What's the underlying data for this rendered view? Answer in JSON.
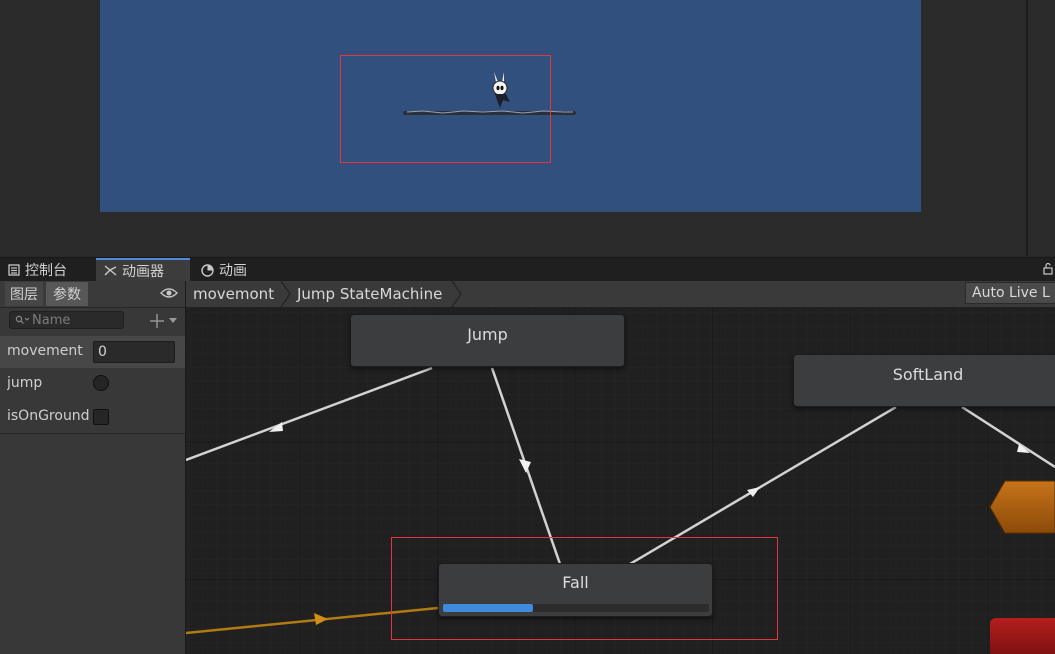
{
  "tabs": [
    {
      "label": "控制台",
      "icon": "console-icon",
      "active": false
    },
    {
      "label": "动画器",
      "icon": "animator-icon",
      "active": true
    },
    {
      "label": "动画",
      "icon": "animation-icon",
      "active": false
    }
  ],
  "panel": {
    "layers_tab": "图层",
    "params_tab": "参数",
    "search_placeholder": "Name",
    "parameters": [
      {
        "name": "movement",
        "type": "float",
        "value": "0"
      },
      {
        "name": "jump",
        "type": "trigger"
      },
      {
        "name": "isOnGround",
        "type": "bool",
        "checked": false
      }
    ]
  },
  "breadcrumb": [
    "movemont",
    "Jump StateMachine"
  ],
  "auto_live": "Auto Live L",
  "states": {
    "jump": "Jump",
    "softland": "SoftLand",
    "fall": "Fall"
  },
  "fall_progress": 0.34,
  "colors": {
    "viewport_bg": "#31507e",
    "selection": "#e0363c",
    "progress": "#3e8bdb",
    "transition": "#d2d2d2",
    "active_transition": "#b07a14",
    "entry_node": "#b5650f",
    "exit_node": "#a01616"
  }
}
